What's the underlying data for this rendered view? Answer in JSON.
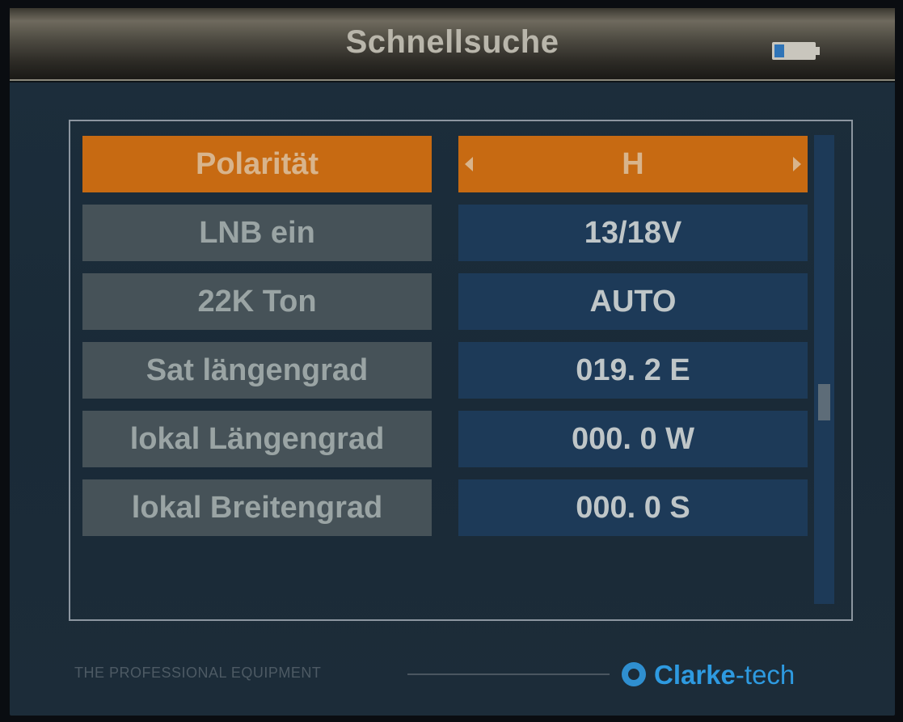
{
  "header": {
    "title": "Schnellsuche",
    "battery_icon": "battery-icon"
  },
  "menu": {
    "rows": [
      {
        "label": "Polarität",
        "value": "H",
        "selected": true
      },
      {
        "label": "LNB ein",
        "value": "13/18V",
        "selected": false
      },
      {
        "label": "22K Ton",
        "value": "AUTO",
        "selected": false
      },
      {
        "label": "Sat längengrad",
        "value": "019. 2 E",
        "selected": false
      },
      {
        "label": "lokal Längengrad",
        "value": "000. 0 W",
        "selected": false
      },
      {
        "label": "lokal Breitengrad",
        "value": "000. 0 S",
        "selected": false
      }
    ]
  },
  "footer": {
    "slogan": "THE PROFESSIONAL EQUIPMENT",
    "brand_strong": "Clarke",
    "brand_light": "-tech",
    "brand_icon": "clarke-tech-logo-icon"
  },
  "colors": {
    "selected": "#c76a12",
    "label_bg": "#465258",
    "value_bg": "#1d3a58",
    "brand": "#2e9ae0"
  }
}
